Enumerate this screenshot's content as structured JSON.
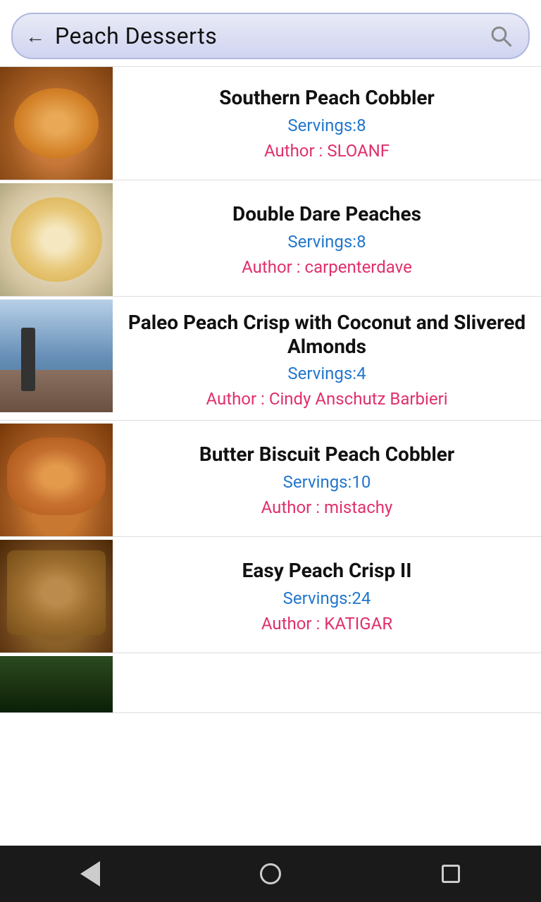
{
  "header": {
    "search_query": "Peach Desserts",
    "back_label": "←",
    "search_icon_label": "search"
  },
  "recipes": [
    {
      "id": "southern-peach-cobbler",
      "title": "Southern Peach Cobbler",
      "servings_label": "Servings:8",
      "author_label": "Author : SLOANF",
      "image_class": "img-cobbler"
    },
    {
      "id": "double-dare-peaches",
      "title": "Double Dare Peaches",
      "servings_label": "Servings:8",
      "author_label": "Author : carpenterdave",
      "image_class": "img-peaches"
    },
    {
      "id": "paleo-peach-crisp",
      "title": "Paleo Peach Crisp with Coconut and Slivered Almonds",
      "servings_label": "Servings:4",
      "author_label": "Author : Cindy Anschutz Barbieri",
      "image_class": "img-crisp-paleo"
    },
    {
      "id": "butter-biscuit-peach-cobbler",
      "title": "Butter Biscuit Peach Cobbler",
      "servings_label": "Servings:10",
      "author_label": "Author : mistachy",
      "image_class": "img-biscuit"
    },
    {
      "id": "easy-peach-crisp-ii",
      "title": "Easy Peach Crisp II",
      "servings_label": "Servings:24",
      "author_label": "Author : KATIGAR",
      "image_class": "img-crisp-easy"
    },
    {
      "id": "partial-item",
      "title": "",
      "servings_label": "",
      "author_label": "",
      "image_class": "img-last"
    }
  ],
  "bottom_nav": {
    "back": "back",
    "home": "home",
    "recents": "recents"
  }
}
